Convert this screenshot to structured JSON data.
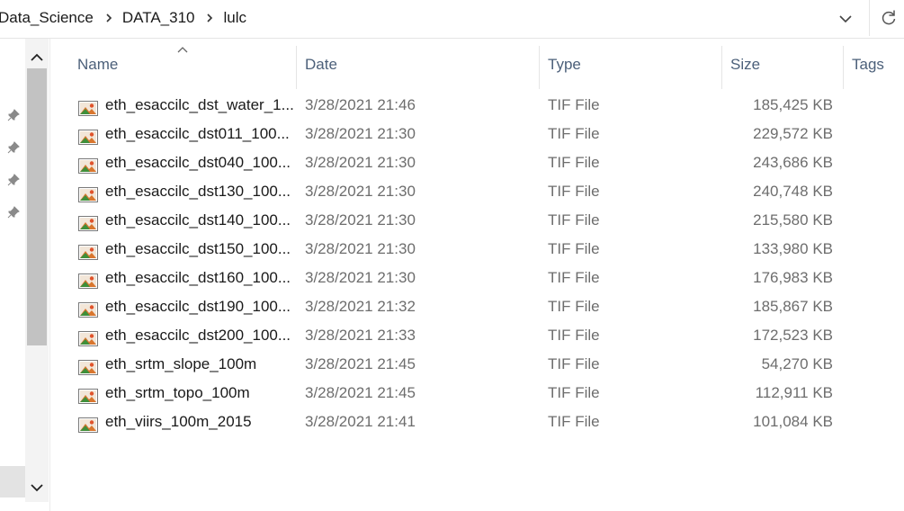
{
  "breadcrumb": [
    "Data_Science",
    "DATA_310",
    "lulc"
  ],
  "address_icons": {
    "dropdown": "chevron-down-icon",
    "refresh": "refresh-icon"
  },
  "columns": {
    "name": "Name",
    "date": "Date",
    "type": "Type",
    "size": "Size",
    "tags": "Tags"
  },
  "sort": {
    "column": "Name",
    "direction": "ascending"
  },
  "files": [
    {
      "name": "eth_esaccilc_dst_water_1...",
      "date": "3/28/2021 21:46",
      "type": "TIF File",
      "size": "185,425 KB"
    },
    {
      "name": "eth_esaccilc_dst011_100...",
      "date": "3/28/2021 21:30",
      "type": "TIF File",
      "size": "229,572 KB"
    },
    {
      "name": "eth_esaccilc_dst040_100...",
      "date": "3/28/2021 21:30",
      "type": "TIF File",
      "size": "243,686 KB"
    },
    {
      "name": "eth_esaccilc_dst130_100...",
      "date": "3/28/2021 21:30",
      "type": "TIF File",
      "size": "240,748 KB"
    },
    {
      "name": "eth_esaccilc_dst140_100...",
      "date": "3/28/2021 21:30",
      "type": "TIF File",
      "size": "215,580 KB"
    },
    {
      "name": "eth_esaccilc_dst150_100...",
      "date": "3/28/2021 21:30",
      "type": "TIF File",
      "size": "133,980 KB"
    },
    {
      "name": "eth_esaccilc_dst160_100...",
      "date": "3/28/2021 21:30",
      "type": "TIF File",
      "size": "176,983 KB"
    },
    {
      "name": "eth_esaccilc_dst190_100...",
      "date": "3/28/2021 21:32",
      "type": "TIF File",
      "size": "185,867 KB"
    },
    {
      "name": "eth_esaccilc_dst200_100...",
      "date": "3/28/2021 21:33",
      "type": "TIF File",
      "size": "172,523 KB"
    },
    {
      "name": "eth_srtm_slope_100m",
      "date": "3/28/2021 21:45",
      "type": "TIF File",
      "size": "54,270 KB"
    },
    {
      "name": "eth_srtm_topo_100m",
      "date": "3/28/2021 21:45",
      "type": "TIF File",
      "size": "112,911 KB"
    },
    {
      "name": "eth_viirs_100m_2015",
      "date": "3/28/2021 21:41",
      "type": "TIF File",
      "size": "101,084 KB"
    }
  ],
  "file_icon": "tif-image-file-icon",
  "nav_pane": {
    "pinned_items": 4,
    "pin_icon": "pin-icon"
  },
  "colors": {
    "header_text": "#4c607a",
    "secondary_text": "#6d6d6d",
    "scroll_thumb": "#c2c2c2"
  }
}
